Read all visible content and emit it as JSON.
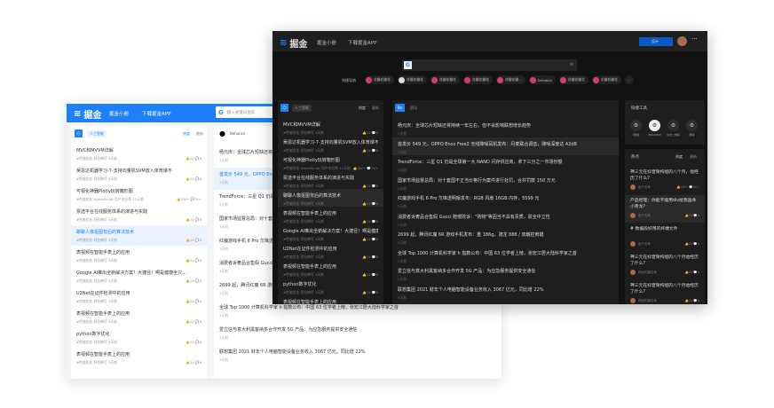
{
  "brand": "掘金",
  "nav": [
    "掘金小册",
    "下载掘金APP"
  ],
  "search": {
    "placeholder": "输入关键词搜索",
    "engine": "G"
  },
  "articles_panel": {
    "category": "人工智能",
    "sort": [
      "热度",
      "最新"
    ]
  },
  "articles": [
    {
      "title": "MVC和MVVM详解",
      "meta": "#性能优化  阿拉神灯  3天前",
      "likes": "24",
      "comments": "6"
    },
    {
      "title": "吴恩达机器学习-7-支持向量机SVM放入体育课不",
      "meta": "#性能优化  阿拉神灯  3天前",
      "likes": "24",
      "comments": "6"
    },
    {
      "title": "可视化神器Plotly玩转箱形图",
      "meta": "#性能优化  #JavaScript  用户名扫帚  12天前",
      "likes": "2W+",
      "comments": "7K+"
    },
    {
      "title": "票选平台在线服务体系的演进与实践",
      "meta": "#性能优化  阿拉神灯  3天前",
      "likes": "24",
      "comments": "6"
    },
    {
      "title": "聊聊人像抠图背后的算法技术",
      "meta": "#性能优化  阿拉神灯  3天前",
      "likes": "24",
      "comments": "6"
    },
    {
      "title": "表视频在智能手表上的应用",
      "meta": "#性能优化  阿拉神灯  3天前",
      "likes": "24",
      "comments": "6"
    },
    {
      "title": "Google AI推出全新解决方案！大捷径！啊是健康坐只...",
      "meta": "#性能优化  阿拉神灯  3天前",
      "likes": "24",
      "comments": "6"
    },
    {
      "title": "U2Net在证件检测中的应用",
      "meta": "#性能优化  阿拉神灯  3天前",
      "likes": "24",
      "comments": "6"
    },
    {
      "title": "表视频在智能手表上的应用",
      "meta": "#性能优化  阿拉神灯  3天前",
      "likes": "24",
      "comments": "6"
    },
    {
      "title": "python数字优化",
      "meta": "#性能优化  阿拉神灯  3天前",
      "likes": "24",
      "comments": "6"
    },
    {
      "title": "表视频在智能手表上的应用",
      "meta": "#性能优化  阿拉神灯  3天前",
      "likes": "24",
      "comments": "6"
    }
  ],
  "news_panel": {
    "source_light": "Behance",
    "source_dark": "资讯"
  },
  "news": [
    {
      "title": "杨元庆：全球芯片短缺还将持续一年左右，但不会影响联想增长趋势",
      "time": "3天前"
    },
    {
      "title": "首发价 549 元，OPPO Enco Free2 无线降噪耳机发布：丹麦联合调音，降噪深度达 42dB",
      "time": "3天前"
    },
    {
      "title": "TrendForce：三星 Q1 仍是全球第一大 NAND 闪存供应商，拿下三分之一市场份额",
      "time": "3天前"
    },
    {
      "title": "国家市场监督总局：对十套国不正当价格行为案件进行处罚，合并罚款 150 万元",
      "time": "3天前"
    },
    {
      "title": "红魔游戏手机 6 Pro 氘锋透明版发布：RGB 风扇 16GB 内存，5599 元",
      "time": "3天前"
    },
    {
      "title": "消费者诉奢品合售假 Gucci 赔偿败诉：\"购物\"等因当不具有责质，驳全中立性",
      "time": "3天前"
    },
    {
      "title": "2699 起，腾讯红魔 6R 游戏手机发布：重 186g，骁龙 888 / 双触控肩键",
      "time": "3天前"
    },
    {
      "title": "全球 Top 1000 计算机科学家 h 指数公布：中国 63 位学者上榜，张宏江居大陆科学家之首",
      "time": "3天前"
    },
    {
      "title": "爱立信与意大利黑客纳多合作开发 5G 产品：为应急服务提供安全通信",
      "time": "3天前"
    },
    {
      "title": "联想集团 2021 财年个人电脑智能设备业务收入 3067 亿元，同比增 22%",
      "time": "3天前"
    }
  ],
  "header_dark": {
    "action": "设计",
    "more": "···"
  },
  "quick_nav": {
    "label": "快捷导航",
    "items": [
      "花瓣花瓣花",
      "花瓣花瓣花",
      "花瓣花瓣花",
      "花瓣花瓣花",
      "花瓣花瓣...",
      "Dribbble",
      "花瓣花瓣花",
      "花瓣花瓣花"
    ],
    "more": "···"
  },
  "tools": {
    "title": "快捷工具",
    "items": [
      "P图板",
      "ENGWIDE",
      "生成二维码",
      "翻译"
    ]
  },
  "hot": {
    "title": "热点",
    "sort": [
      "热度",
      "最新"
    ],
    "items": [
      {
        "title": "神三元在抖音架构组的八个月，他经历了什么?",
        "user": "用户名称",
        "likes": "2W+",
        "comments": "9K+"
      },
      {
        "title": "产品经理：你能不能用div给我画条小青龙?",
        "user": "用户名称",
        "likes": "24",
        "comments": "6"
      },
      {
        "title": "# 数据段好用的终端文件",
        "user": "用户名称",
        "likes": "24",
        "comments": "6"
      },
      {
        "title": "神三元在抖音架构组的八个月他经历了什么?",
        "user": "神经机器名称",
        "likes": "24",
        "comments": "6"
      },
      {
        "title": "神三元在抖音架构组的八个月他经历了什么?",
        "user": "神经机器名称",
        "likes": "24",
        "comments": "6"
      }
    ]
  },
  "colors": {
    "brand": "#1e80ff",
    "dark_bg": "#121212",
    "dark_card": "#1e1e1e",
    "chip": "#d63a7a"
  }
}
